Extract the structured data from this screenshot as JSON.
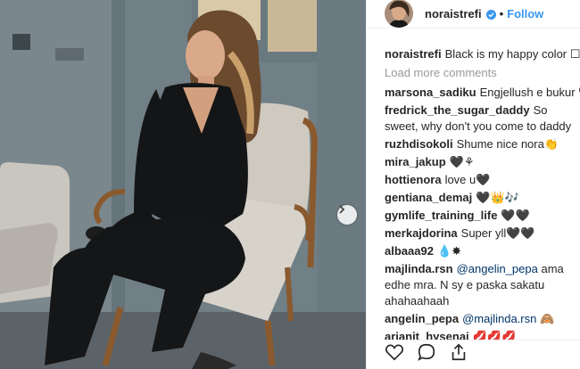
{
  "post": {
    "username": "noraistrefi",
    "follow_label": "Follow",
    "dot": "•",
    "caption": "Black is my happy color ☐",
    "load_more": "Load more comments"
  },
  "comments": [
    {
      "user": "marsona_sadiku",
      "text": "Engjellush e bukur 🖤🎵"
    },
    {
      "user": "fredrick_the_sugar_daddy",
      "text": "So sweet, why don't you come to daddy"
    },
    {
      "user": "ruzhdisokoli",
      "text": "Shume nice nora👏"
    },
    {
      "user": "mira_jakup",
      "text": "🖤⚘"
    },
    {
      "user": "hottienora",
      "text": "love u🖤"
    },
    {
      "user": "gentiana_demaj",
      "text": "🖤👑🎶"
    },
    {
      "user": "gymlife_training_life",
      "text": "🖤🖤"
    },
    {
      "user": "merkajdorina",
      "text": "Super yll🖤🖤"
    },
    {
      "user": "albaaa92",
      "text": "💧✸"
    },
    {
      "user": "majlinda.rsn",
      "mention": "@angelin_pepa",
      "text": " ama edhe mra. N sy e paska sakatu ahahaahaah"
    },
    {
      "user": "angelin_pepa",
      "mention": "@majlinda.rsn",
      "text": " 🙈"
    },
    {
      "user": "arianit_hysenaj",
      "text": "💋💋💋"
    }
  ],
  "icons": {
    "verified": "verified-badge-icon",
    "like": "heart-icon",
    "comment": "comment-icon",
    "share": "share-icon",
    "next": "chevron-right-icon"
  },
  "colors": {
    "link": "#3897f0",
    "verified": "#3897f0",
    "muted": "#999999",
    "text": "#262626"
  }
}
